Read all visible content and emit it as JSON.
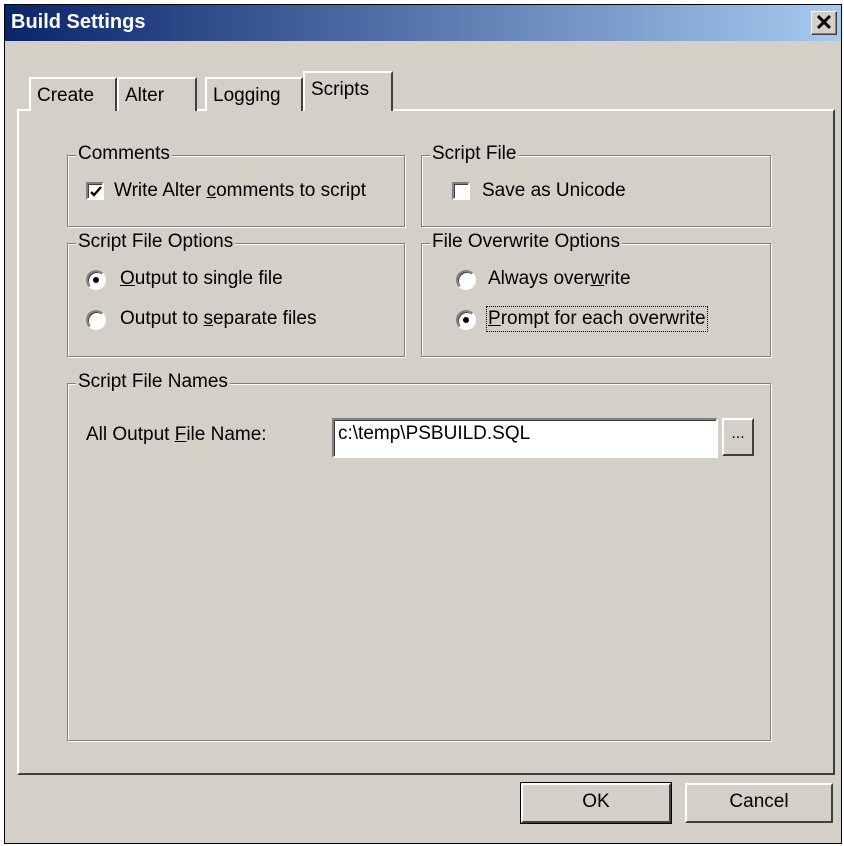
{
  "window": {
    "title": "Build Settings",
    "close_glyph": "✕"
  },
  "tabs": [
    "Create",
    "Alter",
    "Logging",
    "Scripts"
  ],
  "active_tab": "Scripts",
  "comments": {
    "label": "Comments",
    "write_alter": {
      "before": "Write Alter ",
      "ul": "c",
      "after": "omments to script",
      "checked": true
    }
  },
  "script_file": {
    "label": "Script File",
    "save_unicode": {
      "text": "Save as Unicode",
      "checked": false
    }
  },
  "script_file_options": {
    "label": "Script File Options",
    "single": {
      "before": "",
      "ul": "O",
      "after": "utput to single file",
      "selected": true
    },
    "separate": {
      "before": "Output to ",
      "ul": "s",
      "after": "eparate files",
      "selected": false
    }
  },
  "file_overwrite_options": {
    "label": "File Overwrite Options",
    "always": {
      "before": "Always over",
      "ul": "w",
      "after": "rite",
      "selected": false
    },
    "prompt": {
      "before": "",
      "ul": "P",
      "after": "rompt for each overwrite",
      "selected": true
    }
  },
  "script_file_names": {
    "label": "Script File Names",
    "output_label": {
      "before": "All Output ",
      "ul": "F",
      "after": "ile Name:"
    },
    "output_value": "c:\\temp\\PSBUILD.SQL",
    "browse_label": "..."
  },
  "buttons": {
    "ok": "OK",
    "cancel": "Cancel"
  }
}
